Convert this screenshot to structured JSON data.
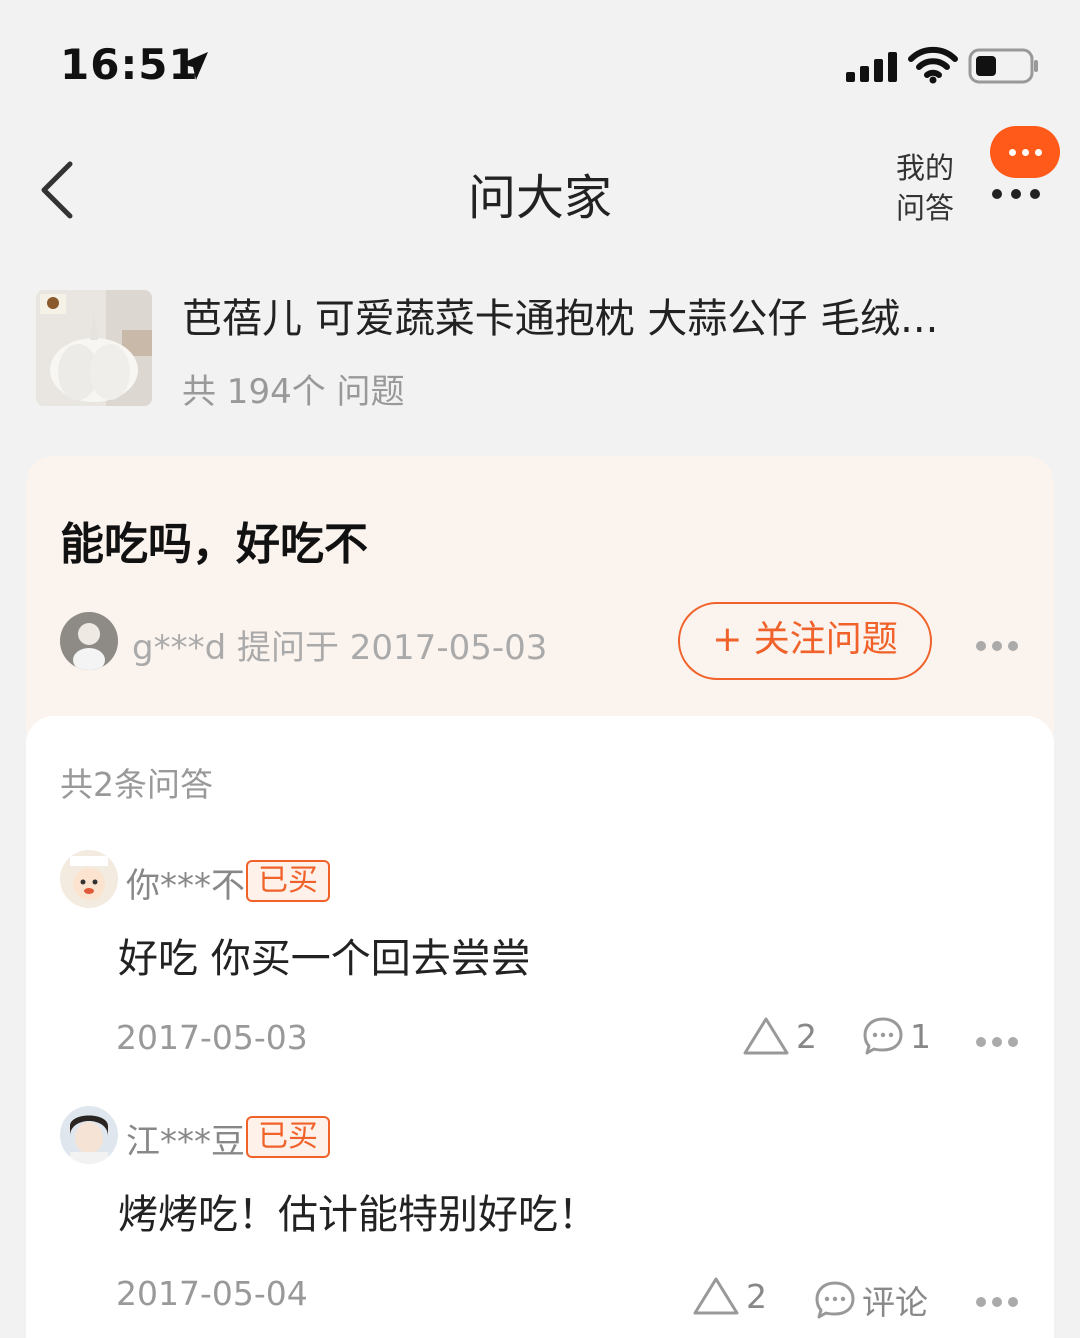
{
  "status_bar": {
    "time": "16:51"
  },
  "nav": {
    "title": "问大家",
    "my_qa_line1": "我的",
    "my_qa_line2": "问答"
  },
  "product": {
    "title": "芭蓓儿 可爱蔬菜卡通抱枕 大蒜公仔 毛绒...",
    "question_count": "共 194个 问题"
  },
  "question": {
    "text": "能吃吗，好吃不",
    "asker": "g***d",
    "asked_at": "提问于 2017-05-03",
    "follow_label": "+ 关注问题"
  },
  "answers": {
    "count_label": "共2条问答",
    "items": [
      {
        "user": "你***不",
        "tag": "已买",
        "text": "好吃 你买一个回去尝尝",
        "date": "2017-05-03",
        "likes": "2",
        "comments": "1"
      },
      {
        "user": "江***豆",
        "tag": "已买",
        "text": "烤烤吃！估计能特别好吃！",
        "date": "2017-05-04",
        "likes": "2",
        "comments": "评论"
      }
    ]
  },
  "colors": {
    "accent": "#f0622a",
    "menu_bubble": "#ff5a1a",
    "question_bg": "#fbf3ee"
  }
}
